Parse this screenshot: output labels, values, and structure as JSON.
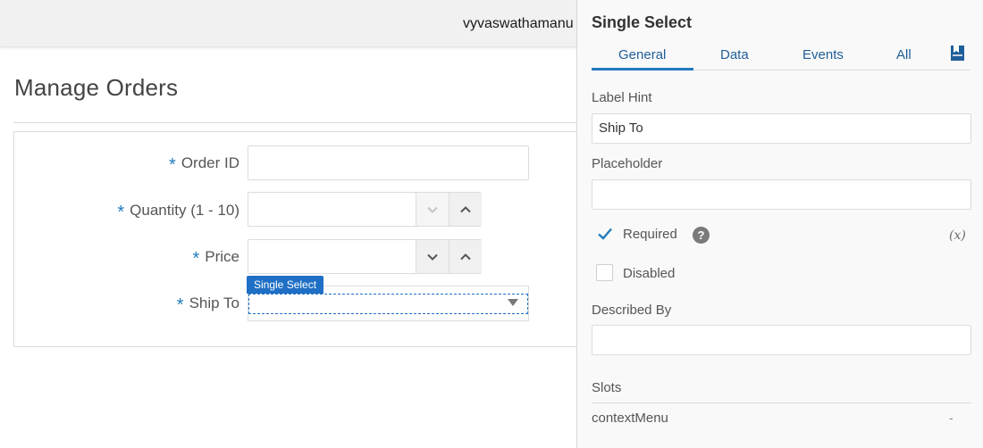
{
  "topbar": {
    "user": "vyvaswathamanu"
  },
  "page": {
    "title": "Manage Orders"
  },
  "form": {
    "required_marker": "*",
    "fields": [
      {
        "label": "Order ID",
        "type": "text",
        "value": ""
      },
      {
        "label": "Quantity (1 - 10)",
        "type": "number",
        "value": ""
      },
      {
        "label": "Price",
        "type": "number",
        "value": ""
      },
      {
        "label": "Ship To",
        "type": "select",
        "value": ""
      }
    ],
    "selected_component_tag": "Single Select"
  },
  "panel": {
    "title": "Single Select",
    "tabs": [
      {
        "label": "General",
        "active": true
      },
      {
        "label": "Data",
        "active": false
      },
      {
        "label": "Events",
        "active": false
      },
      {
        "label": "All",
        "active": false
      }
    ],
    "doc_icon": "bookmark-doc-icon",
    "label_hint": {
      "label": "Label Hint",
      "value": "Ship To"
    },
    "placeholder": {
      "label": "Placeholder",
      "value": ""
    },
    "required": {
      "label": "Required",
      "checked": true,
      "help": "?",
      "variable_marker": "(x)"
    },
    "disabled": {
      "label": "Disabled",
      "checked": false
    },
    "described_by": {
      "label": "Described By",
      "value": ""
    },
    "slots": {
      "title": "Slots",
      "items": [
        {
          "name": "contextMenu",
          "value": "-"
        }
      ]
    }
  },
  "colors": {
    "accent": "#227bbd",
    "tag": "#1f6fc5",
    "required": "#227bbd"
  }
}
